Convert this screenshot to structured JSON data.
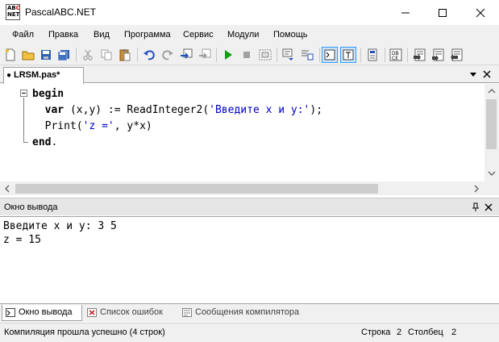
{
  "window": {
    "title": "PascalABC.NET",
    "app_icon": {
      "line1": "AB",
      "line2": "C",
      "line3": "NET"
    }
  },
  "menu": [
    {
      "label": "Файл"
    },
    {
      "label": "Правка"
    },
    {
      "label": "Вид"
    },
    {
      "label": "Программа"
    },
    {
      "label": "Сервис"
    },
    {
      "label": "Модули"
    },
    {
      "label": "Помощь"
    }
  ],
  "toolbar": {
    "icons": [
      "new-file-icon",
      "open-icon",
      "save-icon",
      "save-all-icon",
      "cut-icon",
      "copy-icon",
      "paste-icon",
      "undo-icon",
      "redo-icon",
      "compile-icon",
      "build-icon",
      "run-icon",
      "stop-icon",
      "debug-icon",
      "format-icon",
      "output-window-icon",
      "text-icon",
      "form-icon",
      "cell-icon",
      "step-icon",
      "breakpoint-icon",
      "step-out-icon"
    ]
  },
  "editor_tab": {
    "label": "LRSM.pas*",
    "modified_marker": "●"
  },
  "code": {
    "line1_kw": "begin",
    "line2_kw": "var",
    "line2_rest": " (x,y) := ReadInteger2(",
    "line2_str": "'Введите x и y:'",
    "line2_end": ");",
    "line3_fn": "Print(",
    "line3_str": "'z ='",
    "line3_rest": ", y*x)",
    "line4_kw": "end",
    "line4_end": "."
  },
  "output_panel": {
    "title": "Окно вывода",
    "lines": [
      "Введите x и y: 3 5",
      "z = 15"
    ]
  },
  "bottom_tabs": [
    {
      "label": "Окно вывода",
      "active": true
    },
    {
      "label": "Список ошибок",
      "active": false
    },
    {
      "label": "Сообщения компилятора",
      "active": false
    }
  ],
  "status": {
    "message": "Компиляция прошла успешно (4 строк)",
    "line_label": "Строка",
    "line_value": "2",
    "col_label": "Столбец",
    "col_value": "2"
  }
}
